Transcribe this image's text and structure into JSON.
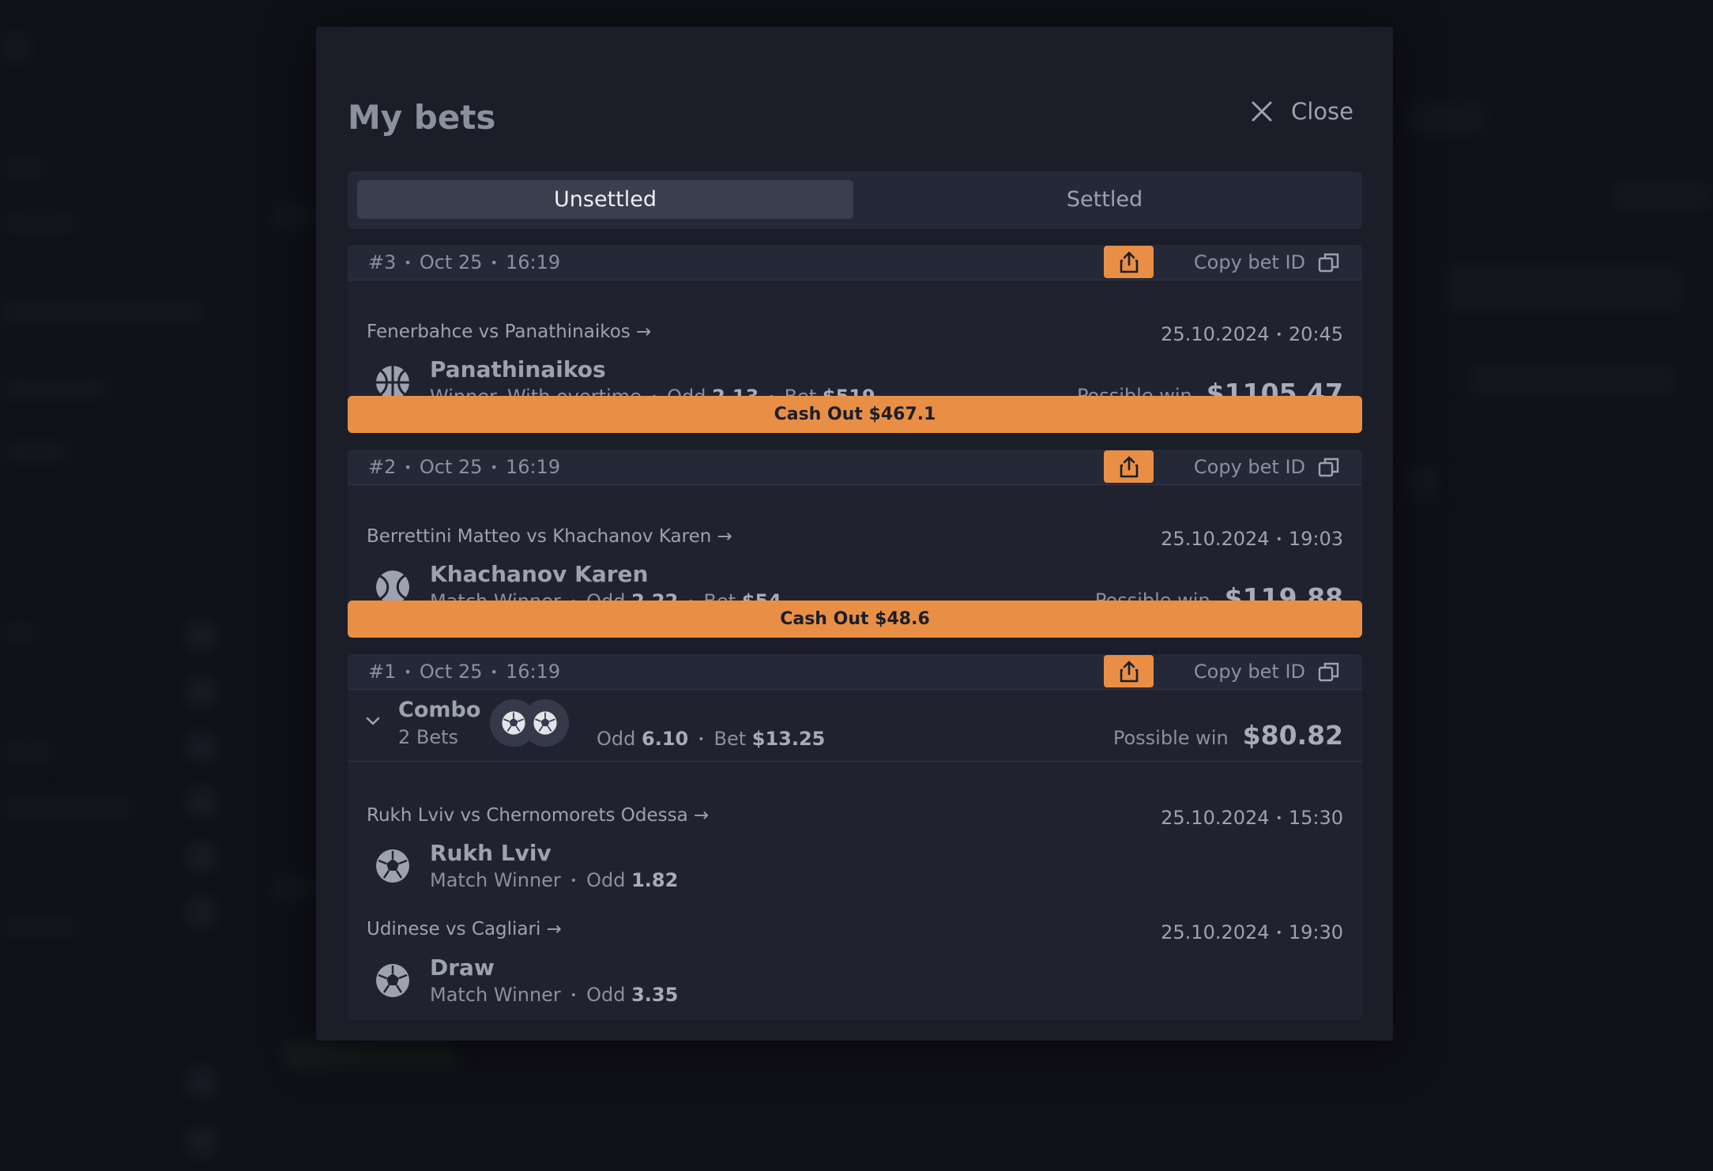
{
  "modal": {
    "title": "My bets",
    "close_label": "Close",
    "tabs": [
      {
        "label": "Unsettled",
        "active": true
      },
      {
        "label": "Settled",
        "active": false
      }
    ]
  },
  "copy_label": "Copy bet ID",
  "bets": [
    {
      "id": "#3",
      "date": "Oct 25",
      "time": "16:19",
      "match": "Fenerbahce vs Panathinaikos →",
      "event_date": "25.10.2024",
      "event_time": "20:45",
      "sport_icon": "basketball-icon",
      "pick": "Panathinaikos",
      "market": "Winner. With overtime",
      "odd_label": "Odd",
      "odd": "2.13",
      "bet_label": "Bet",
      "bet": "$519",
      "win_label": "Possible win",
      "win": "$1105.47",
      "cashout": "Cash Out $467.1"
    },
    {
      "id": "#2",
      "date": "Oct 25",
      "time": "16:19",
      "match": "Berrettini Matteo vs Khachanov Karen →",
      "event_date": "25.10.2024",
      "event_time": "19:03",
      "sport_icon": "tennis-ball-icon",
      "pick": "Khachanov Karen",
      "market": "Match Winner",
      "odd_label": "Odd",
      "odd": "2.22",
      "bet_label": "Bet",
      "bet": "$54",
      "win_label": "Possible win",
      "win": "$119.88",
      "cashout": "Cash Out $48.6"
    }
  ],
  "combo": {
    "id": "#1",
    "date": "Oct 25",
    "time": "16:19",
    "title": "Combo",
    "count": "2 Bets",
    "odd_label": "Odd",
    "odd": "6.10",
    "bet_label": "Bet",
    "bet": "$13.25",
    "win_label": "Possible win",
    "win": "$80.82",
    "legs": [
      {
        "match": "Rukh Lviv vs Chernomorets Odessa →",
        "event_date": "25.10.2024",
        "event_time": "15:30",
        "sport_icon": "soccer-ball-icon",
        "pick": "Rukh Lviv",
        "market": "Match Winner",
        "odd_label": "Odd",
        "odd": "1.82"
      },
      {
        "match": "Udinese vs Cagliari →",
        "event_date": "25.10.2024",
        "event_time": "19:30",
        "sport_icon": "soccer-ball-icon",
        "pick": "Draw",
        "market": "Match Winner",
        "odd_label": "Odd",
        "odd": "3.35"
      }
    ]
  },
  "colors": {
    "accent": "#e88f45",
    "modal_bg": "#1b1e29",
    "card_bg": "#20232f"
  }
}
